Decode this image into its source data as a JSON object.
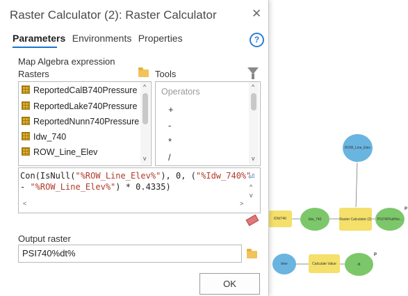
{
  "dialog": {
    "title": "Raster Calculator (2): Raster Calculator",
    "close_glyph": "✕",
    "tabs": [
      "Parameters",
      "Environments",
      "Properties"
    ],
    "help_glyph": "?",
    "map_algebra_label": "Map Algebra expression",
    "rasters_label": "Rasters",
    "tools_label": "Tools",
    "rasters": [
      "ReportedCalB740Pressure",
      "ReportedLake740Pressure",
      "ReportedNunn740Pressure",
      "Idw_740",
      "ROW_Line_Elev"
    ],
    "operators_title": "Operators",
    "operators": [
      "+",
      "-",
      "*",
      "/"
    ],
    "expression_line1_a": "Con(IsNull(",
    "expression_line1_b": "\"%ROW_Line_Elev%\"",
    "expression_line1_c": "), 0, (",
    "expression_line1_d": "\"%Idw_740%\"",
    "expression_line2_a": " - ",
    "expression_line2_b": "\"%ROW_Line_Elev%\"",
    "expression_line2_c": ") * 0.4335)",
    "output_raster_label": "Output raster",
    "output_raster_value": "PSI740%dt%",
    "ok_label": "OK",
    "scroll_up": "^",
    "scroll_down": "v",
    "scroll_left": "<",
    "scroll_right": ">",
    "wrap_glyph": "⏎"
  },
  "model": {
    "nodes": {
      "row_line_elev": "ROW_Line_Elev",
      "idw740_input": "IDW740",
      "idw_740": "Idw_740",
      "raster_calculator": "Raster Calculator (2)",
      "psi740": "PSI740%dt%e...",
      "time": "time",
      "calculate_value": "Calculate Value",
      "dt": "dt"
    },
    "p_tag": "P",
    "colors": {
      "blue": "#6ab4e0",
      "green": "#7cc76a",
      "yellow": "#f4e06a"
    }
  }
}
